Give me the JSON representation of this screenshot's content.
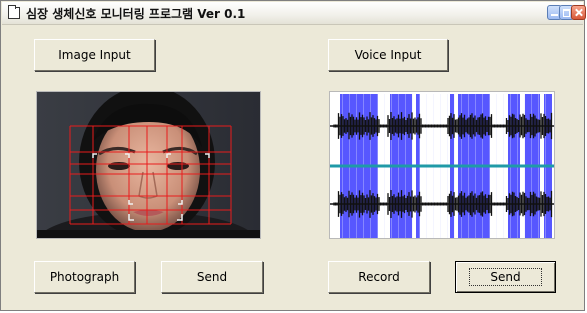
{
  "window": {
    "title": "심장 생체신호 모니터링 프로그램 Ver 0.1"
  },
  "buttons": {
    "image_input": "Image Input",
    "voice_input": "Voice Input",
    "photograph": "Photograph",
    "send_image": "Send",
    "record": "Record",
    "send_voice": "Send"
  },
  "panels": {
    "face": {
      "grid_color": "#e81c1c"
    },
    "waveform": {
      "band_color": "#3a3aff",
      "midline_color": "#1f9aa7"
    }
  }
}
